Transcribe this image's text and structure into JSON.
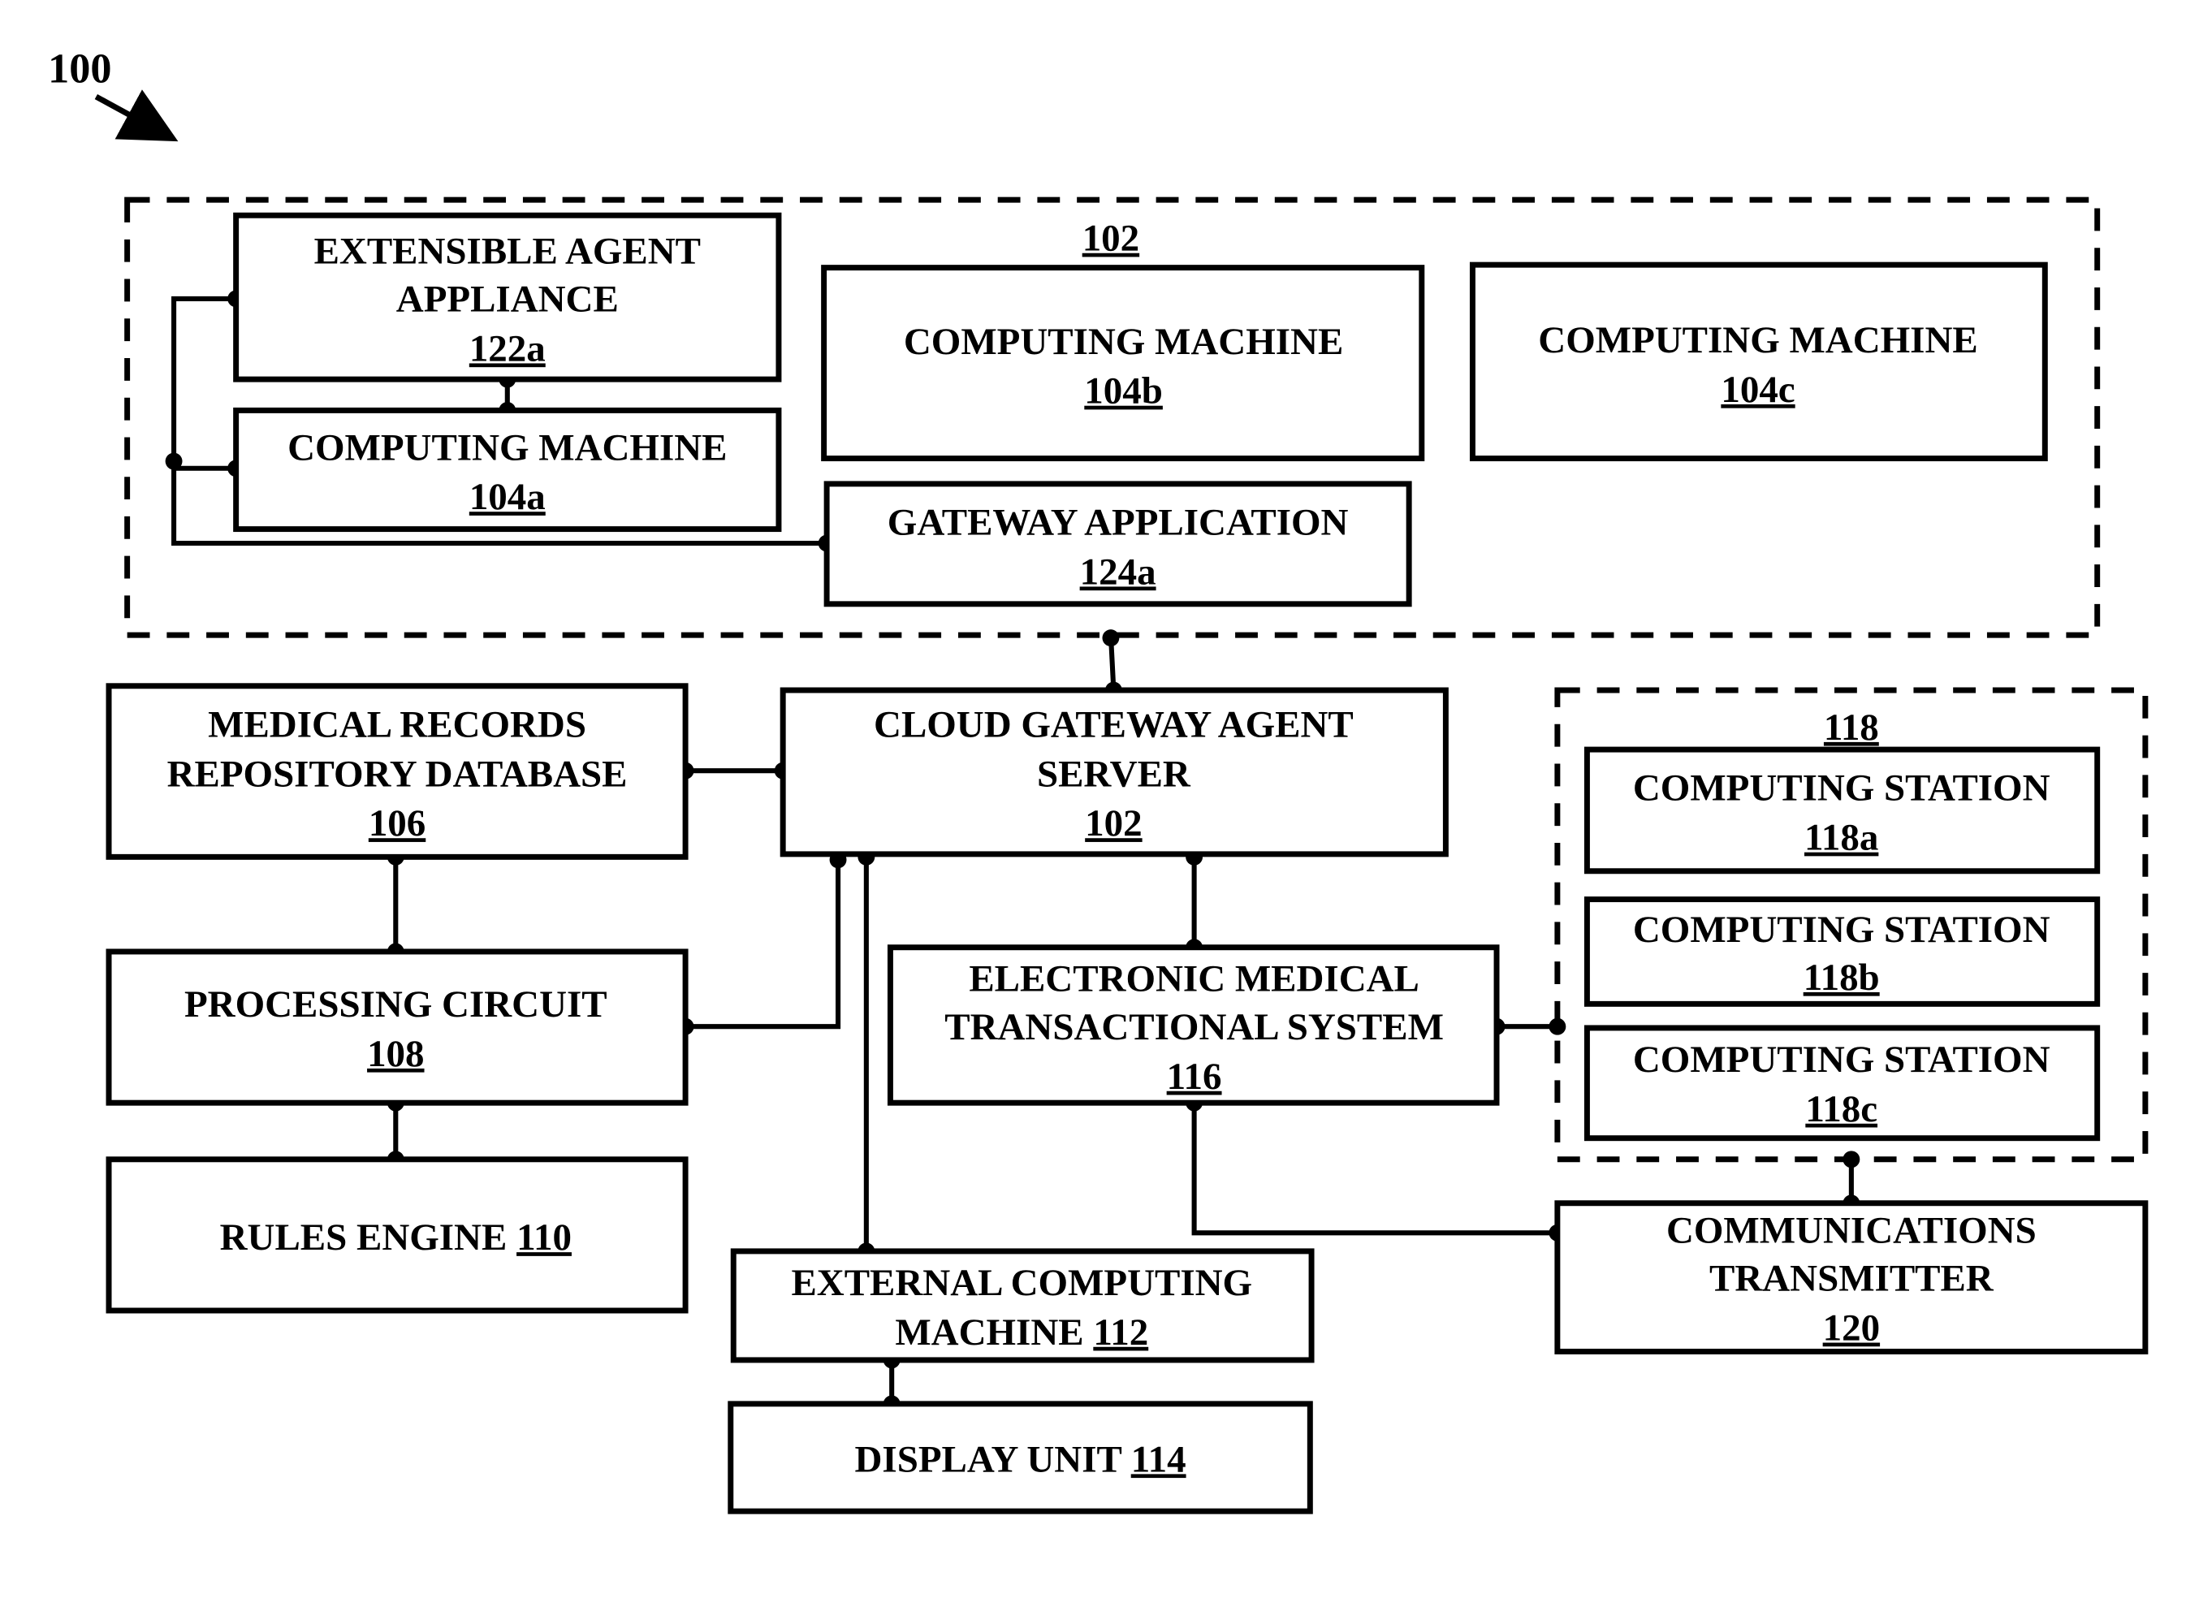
{
  "figure": {
    "label": "100"
  },
  "groups": {
    "top_group_label": "102",
    "stations_group_label": "118"
  },
  "boxes": {
    "b122a": {
      "line1": "EXTENSIBLE AGENT",
      "line2": "APPLIANCE",
      "ref": "122a"
    },
    "b104a": {
      "line1": "COMPUTING  MACHINE",
      "ref": "104a"
    },
    "b104b": {
      "line1": "COMPUTING MACHINE",
      "ref": "104b"
    },
    "b104c": {
      "line1": "COMPUTING MACHINE",
      "ref": "104c"
    },
    "b124a": {
      "line1": "GATEWAY APPLICATION",
      "ref": "124a"
    },
    "b106": {
      "line1": "MEDICAL RECORDS",
      "line2": "REPOSITORY DATABASE",
      "ref": "106"
    },
    "b102": {
      "line1": "CLOUD GATEWAY AGENT",
      "line2": "SERVER",
      "ref": "102"
    },
    "b108": {
      "line1": "PROCESSING CIRCUIT",
      "ref": "108"
    },
    "b110": {
      "line1": "RULES ENGINE ",
      "ref": "110"
    },
    "b116": {
      "line1": "ELECTRONIC MEDICAL",
      "line2": "TRANSACTIONAL SYSTEM",
      "ref": "116"
    },
    "b118a": {
      "line1": "COMPUTING STATION",
      "ref": "118a"
    },
    "b118b": {
      "line1": "COMPUTING STATION",
      "ref": "118b"
    },
    "b118c": {
      "line1": "COMPUTING STATION",
      "ref": "118c"
    },
    "b112": {
      "line1": "EXTERNAL COMPUTING",
      "line2": "MACHINE ",
      "ref": "112"
    },
    "b114": {
      "line1": "DISPLAY UNIT ",
      "ref": "114"
    },
    "b120": {
      "line1": "COMMUNICATIONS",
      "line2": "TRANSMITTER",
      "ref": "120"
    }
  }
}
